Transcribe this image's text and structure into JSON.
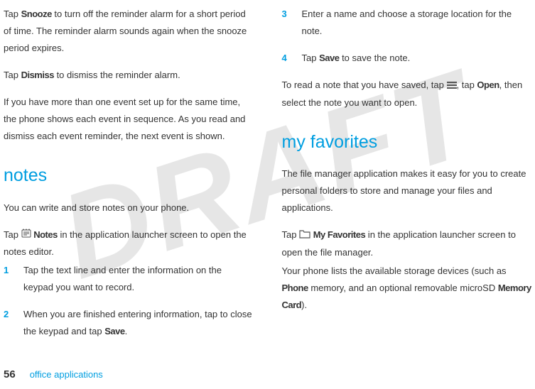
{
  "watermark": "DRAFT",
  "left": {
    "p1a": "Tap ",
    "p1_snooze": "Snooze",
    "p1b": " to turn off the reminder alarm for a short period of time. The reminder alarm sounds again when the snooze period expires.",
    "p2a": "Tap ",
    "p2_dismiss": "Dismiss",
    "p2b": " to dismiss the reminder alarm.",
    "p3": "If you have more than one event set up for the same time, the phone shows each event in sequence. As you read and dismiss each event reminder, the next event is shown.",
    "h_notes": "notes",
    "p4": "You can write and store notes on your phone.",
    "p5a": "Tap ",
    "p5_notes": "Notes",
    "p5b": " in the application launcher screen to open the notes editor.",
    "s1": "Tap the text line and enter the information on the keypad you want to record.",
    "s2a": "When you are finished entering information, tap to close the keypad and tap ",
    "s2_save": "Save",
    "s2b": "."
  },
  "right": {
    "s3": "Enter a name and choose a storage location for the note.",
    "s4a": "Tap ",
    "s4_save": "Save",
    "s4b": " to save the note.",
    "p6a": "To read a note that you have saved, tap ",
    "p6b": ", tap ",
    "p6_open": "Open",
    "p6c": ", then select the note you want to open.",
    "h_fav": "my favorites",
    "p7": "The file manager application makes it easy for you to create personal folders to store and manage your files and applications.",
    "p8a": "Tap ",
    "p8_fav": "My Favorites",
    "p8b": " in the application launcher screen to open the file manager.",
    "p9a": "Your phone lists the available storage devices (such as ",
    "p9_phone": "Phone",
    "p9b": " memory, and an optional removable microSD ",
    "p9_card": "Memory Card",
    "p9c": ")."
  },
  "icons": {
    "notes": "notes-icon",
    "menu": "menu-icon",
    "folder": "folder-icon"
  },
  "footer": {
    "page": "56",
    "section": "office applications"
  }
}
